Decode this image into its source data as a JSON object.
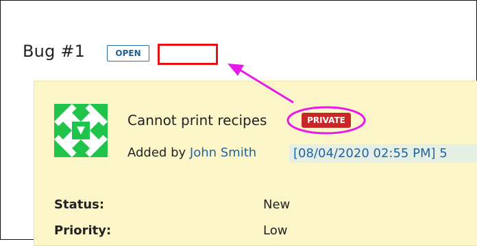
{
  "bug": {
    "title": "Bug #1",
    "state_badge": "OPEN",
    "summary": "Cannot print recipes",
    "privacy_badge": "PRIVATE",
    "added_by_prefix": "Added by",
    "author": "John Smith",
    "timestamp": "[08/04/2020 02:55 PM] 5"
  },
  "fields": [
    {
      "label": "Status:",
      "value": "New"
    },
    {
      "label": "Priority:",
      "value": "Low"
    }
  ],
  "colors": {
    "annotation_arrow": "#e619e6",
    "highlight_box": "#e81010",
    "card_background": "#fdf6c8",
    "private_badge": "#c62828",
    "open_badge_border": "#2a6ea8",
    "avatar_green": "#21c44b"
  }
}
